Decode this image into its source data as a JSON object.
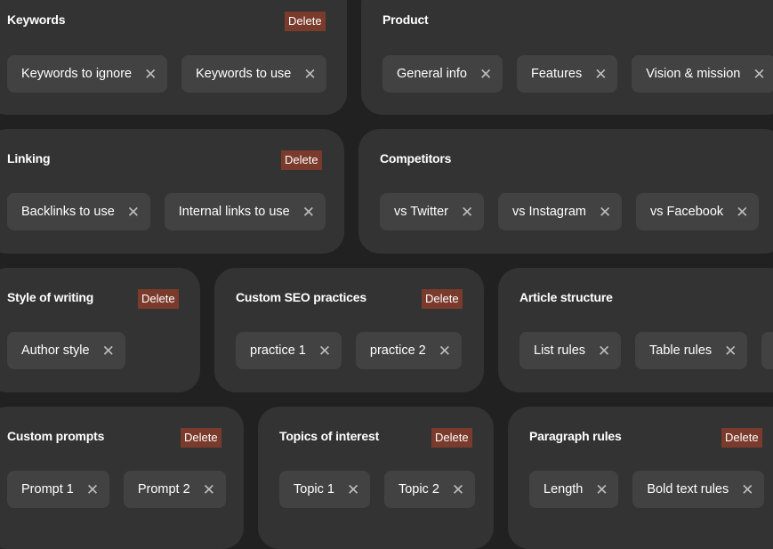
{
  "delete_label": "Delete",
  "close_glyph": "✕",
  "colors": {
    "background": "#212121",
    "card": "#333333",
    "chip": "#424242",
    "delete": "#7a3b2c"
  },
  "cards": {
    "keywords": {
      "title": "Keywords",
      "chips": [
        "Keywords to ignore",
        "Keywords to use"
      ]
    },
    "product": {
      "title": "Product",
      "chips": [
        "General info",
        "Features",
        "Vision & mission"
      ]
    },
    "linking": {
      "title": "Linking",
      "chips": [
        "Backlinks to use",
        "Internal links to use"
      ]
    },
    "competitors": {
      "title": "Competitors",
      "chips": [
        "vs Twitter",
        "vs Instagram",
        "vs Facebook"
      ]
    },
    "style": {
      "title": "Style of writing",
      "chips": [
        "Author style"
      ]
    },
    "seo": {
      "title": "Custom SEO practices",
      "chips": [
        "practice 1",
        "practice 2"
      ]
    },
    "article": {
      "title": "Article structure",
      "chips": [
        "List rules",
        "Table rules"
      ]
    },
    "prompts": {
      "title": "Custom prompts",
      "chips": [
        "Prompt 1",
        "Prompt 2"
      ]
    },
    "topics": {
      "title": "Topics of interest",
      "chips": [
        "Topic 1",
        "Topic 2"
      ]
    },
    "paragraph": {
      "title": "Paragraph rules",
      "chips": [
        "Length",
        "Bold text rules"
      ]
    }
  }
}
